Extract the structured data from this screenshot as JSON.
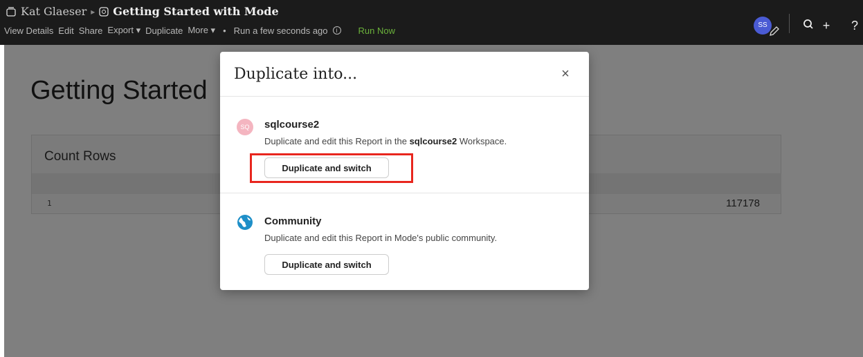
{
  "topbar": {
    "owner": "Kat Glaeser",
    "report_title": "Getting Started with Mode",
    "actions": [
      "View Details",
      "Edit",
      "Share",
      "Export ▾",
      "Duplicate",
      "More ▾",
      "•"
    ],
    "run_status": "Run a few seconds ago",
    "run_now": "Run Now",
    "avatar_initials": "SS"
  },
  "page": {
    "title": "Getting Started",
    "panel_title": "Count Rows",
    "row_number": "1",
    "cell_value": "117178"
  },
  "modal": {
    "title": "Duplicate into...",
    "close_label": "×",
    "workspaces": [
      {
        "badge": "SQ",
        "name": "sqlcourse2",
        "desc_prefix": "Duplicate and edit this Report in the ",
        "desc_bold": "sqlcourse2",
        "desc_suffix": " Workspace.",
        "button": "Duplicate and switch"
      },
      {
        "name": "Community",
        "desc": "Duplicate and edit this Report in Mode's public community.",
        "button": "Duplicate and switch"
      }
    ]
  },
  "colors": {
    "accent_run": "#6bb23b",
    "highlight": "#e8261e",
    "avatar": "#4a5bd4",
    "globe": "#1e8fc8"
  }
}
